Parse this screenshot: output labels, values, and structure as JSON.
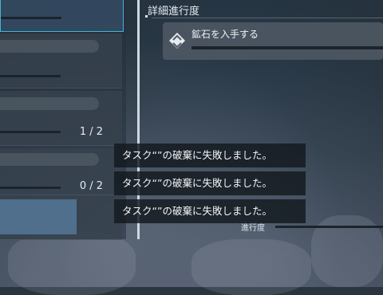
{
  "details": {
    "title": "詳細進行度",
    "objective": {
      "label": "鉱石を入手する",
      "icon": "diamond-chevron-icon"
    }
  },
  "tasks": [
    {
      "count": "",
      "selected": true
    },
    {
      "count": ""
    },
    {
      "count": "1 / 2"
    },
    {
      "count": "0 / 2"
    },
    {
      "count": ""
    }
  ],
  "toasts": [
    "タスク“”の破棄に失敗しました。",
    "タスク“”の破棄に失敗しました。",
    "タスク“”の破棄に失敗しました。"
  ],
  "footer": {
    "progress_label": "進行度"
  },
  "colors": {
    "accent": "#3fb6d8",
    "panel": "#37424e"
  }
}
